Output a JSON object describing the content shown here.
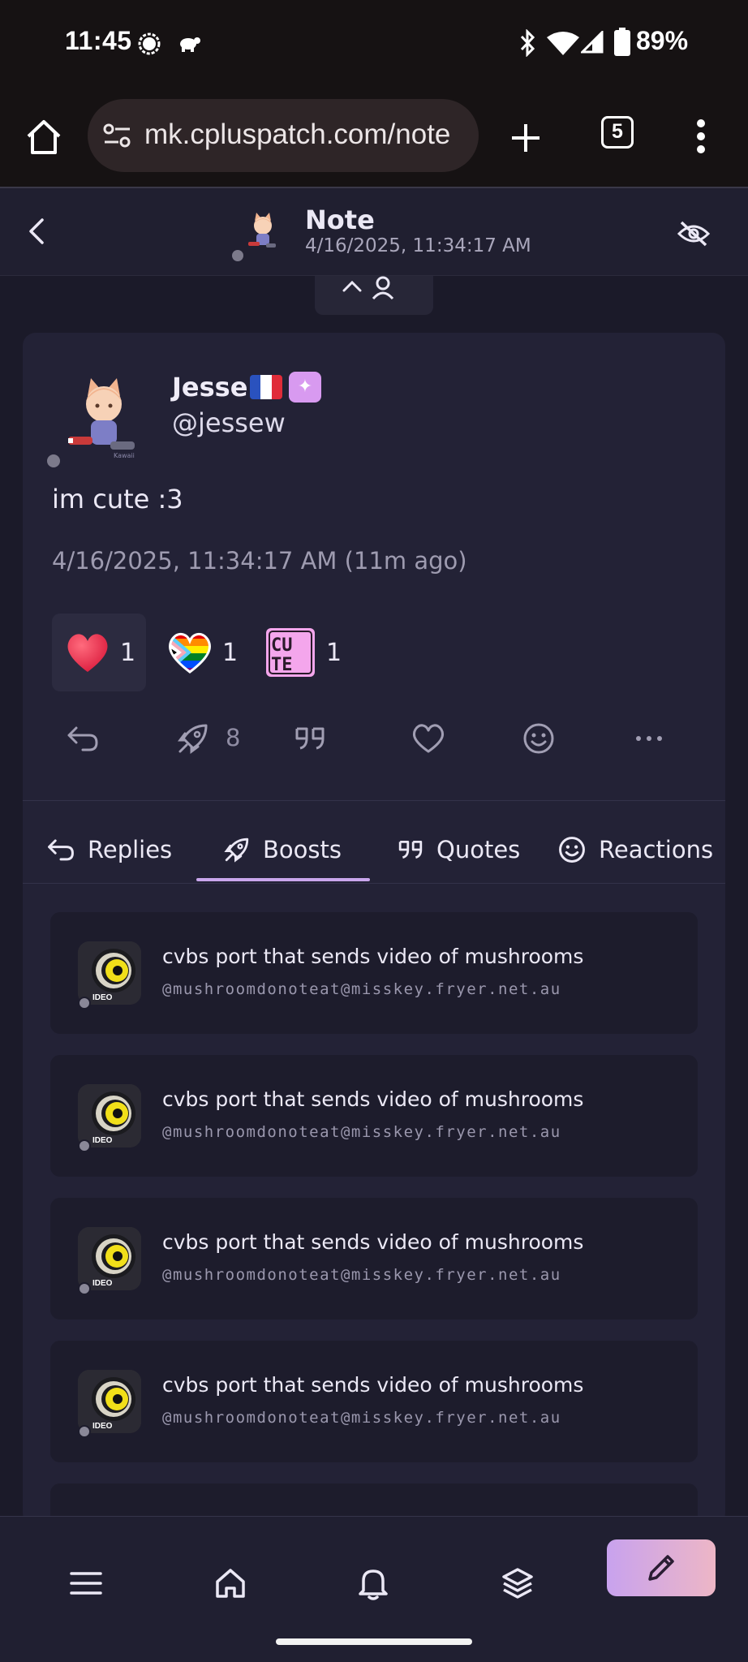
{
  "status_bar": {
    "time": "11:45",
    "battery": "89%"
  },
  "browser": {
    "url": "mk.cpluspatch.com/note",
    "tab_count": "5"
  },
  "header": {
    "title": "Note",
    "subtitle": "4/16/2025, 11:34:17 AM"
  },
  "note": {
    "author_name": "Jesse",
    "author_handle": "@jessew",
    "text": "im cute :3",
    "timestamp": "4/16/2025, 11:34:17 AM (11m ago)",
    "reactions": [
      {
        "emoji": "heart",
        "count": "1"
      },
      {
        "emoji": "progress-pride-heart",
        "count": "1"
      },
      {
        "emoji": "cute",
        "count": "1"
      }
    ],
    "boost_count": "8"
  },
  "tabs": [
    {
      "label": "Replies",
      "icon": "reply-icon"
    },
    {
      "label": "Boosts",
      "icon": "rocket-icon",
      "active": true
    },
    {
      "label": "Quotes",
      "icon": "quote-icon"
    },
    {
      "label": "Reactions",
      "icon": "smile-icon"
    }
  ],
  "boosters": [
    {
      "name": "cvbs port that sends video of mushrooms",
      "handle": "@mushroomdonoteat@misskey.fryer.net.au",
      "avatar_label": "IDEO"
    },
    {
      "name": "cvbs port that sends video of mushrooms",
      "handle": "@mushroomdonoteat@misskey.fryer.net.au",
      "avatar_label": "IDEO"
    },
    {
      "name": "cvbs port that sends video of mushrooms",
      "handle": "@mushroomdonoteat@misskey.fryer.net.au",
      "avatar_label": "IDEO"
    },
    {
      "name": "cvbs port that sends video of mushrooms",
      "handle": "@mushroomdonoteat@misskey.fryer.net.au",
      "avatar_label": "IDEO"
    }
  ],
  "colors": {
    "accent": "#c9a6ec",
    "background": "#1b1a29",
    "card": "#232236"
  }
}
